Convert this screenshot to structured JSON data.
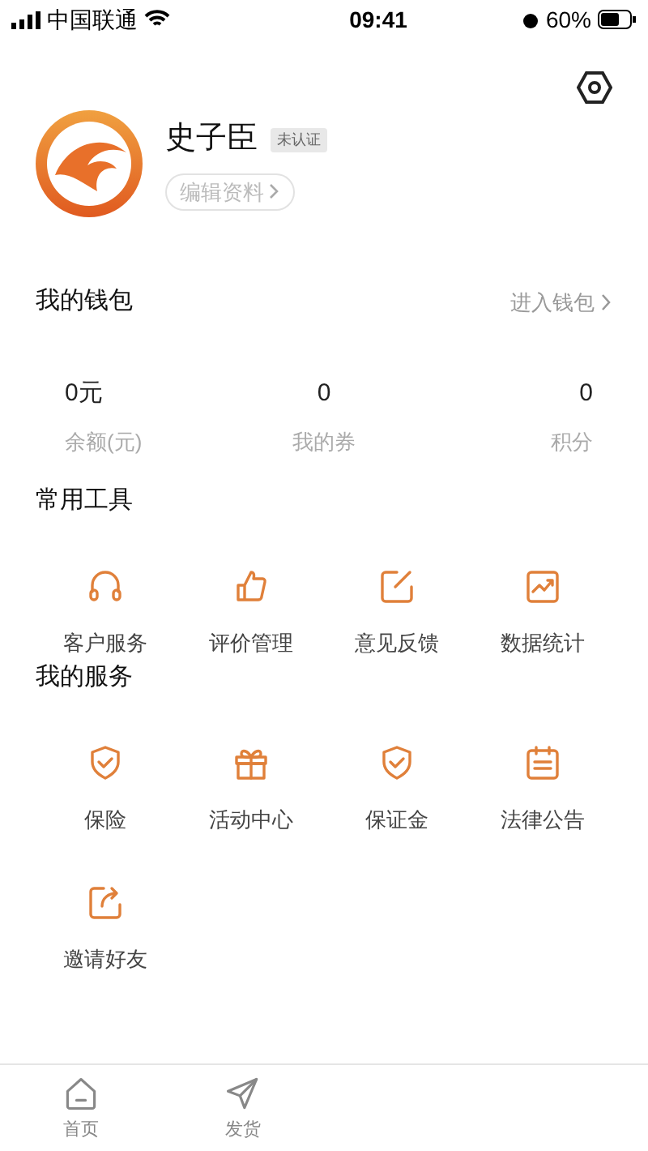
{
  "status_bar": {
    "carrier": "中国联通",
    "time": "09:41",
    "battery": "60%"
  },
  "profile": {
    "name": "史子臣",
    "badge": "未认证",
    "edit_button": "编辑资料"
  },
  "wallet": {
    "title": "我的钱包",
    "link": "进入钱包",
    "stats": [
      {
        "value": "0元",
        "label": "余额(元)"
      },
      {
        "value": "0",
        "label": "我的券"
      },
      {
        "value": "0",
        "label": "积分"
      }
    ]
  },
  "tools": {
    "title": "常用工具",
    "items": [
      {
        "kind": "headset",
        "label": "客户服务"
      },
      {
        "kind": "thumb",
        "label": "评价管理"
      },
      {
        "kind": "edit",
        "label": "意见反馈"
      },
      {
        "kind": "chart",
        "label": "数据统计"
      }
    ]
  },
  "services": {
    "title": "我的服务",
    "items": [
      {
        "kind": "shield",
        "label": "保险"
      },
      {
        "kind": "gift",
        "label": "活动中心"
      },
      {
        "kind": "shield",
        "label": "保证金"
      },
      {
        "kind": "calendar",
        "label": "法律公告"
      },
      {
        "kind": "share",
        "label": "邀请好友"
      }
    ]
  },
  "tab_bar": [
    {
      "kind": "home",
      "label": "首页",
      "selected": false
    },
    {
      "kind": "send",
      "label": "发货",
      "selected": false
    }
  ]
}
